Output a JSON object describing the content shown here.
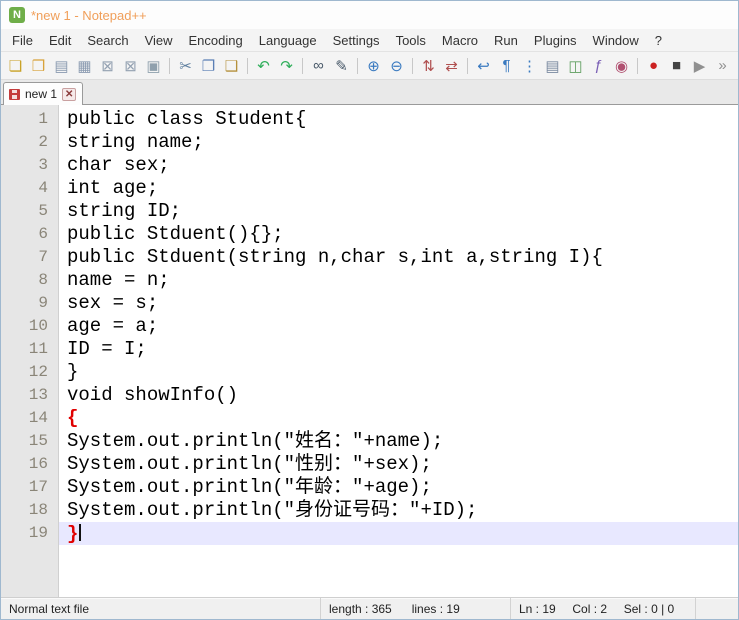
{
  "window": {
    "title": "*new 1 - Notepad++"
  },
  "colors": {
    "title_text": "#f09f5a",
    "app_icon_green": "#6fae49",
    "brace_match": "#e00000",
    "current_line_highlight": "#e8e8ff",
    "unsaved_tab_icon": "#c43c3c"
  },
  "menu_bar": {
    "items": [
      "File",
      "Edit",
      "Search",
      "View",
      "Encoding",
      "Language",
      "Settings",
      "Tools",
      "Macro",
      "Run",
      "Plugins",
      "Window",
      "?"
    ]
  },
  "toolbar": {
    "items": [
      {
        "name": "new-file-icon",
        "glyph": "❏",
        "color": "#c9a227"
      },
      {
        "name": "open-file-icon",
        "glyph": "❒",
        "color": "#d8a33c"
      },
      {
        "name": "save-file-icon",
        "glyph": "▤",
        "color": "#8a9ab0"
      },
      {
        "name": "save-all-icon",
        "glyph": "▦",
        "color": "#8a9ab0"
      },
      {
        "name": "close-file-icon",
        "glyph": "⊠",
        "color": "#93a1b1"
      },
      {
        "name": "close-all-icon",
        "glyph": "⊠",
        "color": "#93a1b1"
      },
      {
        "name": "print-icon",
        "glyph": "▣",
        "color": "#8fa0ad"
      },
      {
        "type": "sep"
      },
      {
        "name": "cut-icon",
        "glyph": "✂",
        "color": "#5f7f9f"
      },
      {
        "name": "copy-icon",
        "glyph": "❐",
        "color": "#5b7fb5"
      },
      {
        "name": "paste-icon",
        "glyph": "❑",
        "color": "#b5913c"
      },
      {
        "type": "sep"
      },
      {
        "name": "undo-icon",
        "glyph": "↶",
        "color": "#2fae5a"
      },
      {
        "name": "redo-icon",
        "glyph": "↷",
        "color": "#2fae5a"
      },
      {
        "type": "sep"
      },
      {
        "name": "find-icon",
        "glyph": "∞",
        "color": "#4a5a6a"
      },
      {
        "name": "replace-icon",
        "glyph": "✎",
        "color": "#4a5a6a"
      },
      {
        "type": "sep"
      },
      {
        "name": "zoom-in-icon",
        "glyph": "⊕",
        "color": "#3a7ac0"
      },
      {
        "name": "zoom-out-icon",
        "glyph": "⊖",
        "color": "#3a7ac0"
      },
      {
        "type": "sep"
      },
      {
        "name": "sync-vertical-scroll-icon",
        "glyph": "⇅",
        "color": "#b05050"
      },
      {
        "name": "sync-horizontal-scroll-icon",
        "glyph": "⇄",
        "color": "#b05050"
      },
      {
        "type": "sep"
      },
      {
        "name": "word-wrap-icon",
        "glyph": "↩",
        "color": "#3a7ac0"
      },
      {
        "name": "show-all-characters-icon",
        "glyph": "¶",
        "color": "#3a7ac0"
      },
      {
        "name": "indent-guide-icon",
        "glyph": "⋮",
        "color": "#3a7ac0"
      },
      {
        "name": "define-language-icon",
        "glyph": "▤",
        "color": "#7a8aa0"
      },
      {
        "name": "document-map-icon",
        "glyph": "◫",
        "color": "#5f9e5f"
      },
      {
        "name": "function-list-icon",
        "glyph": "ƒ",
        "color": "#7a5fb5"
      },
      {
        "name": "monitoring-icon",
        "glyph": "◉",
        "color": "#b05070"
      },
      {
        "type": "sep"
      },
      {
        "name": "record-macro-icon",
        "glyph": "●",
        "color": "#cc2222"
      },
      {
        "name": "stop-macro-icon",
        "glyph": "■",
        "color": "#444444"
      },
      {
        "name": "playback-macro-icon",
        "glyph": "▶",
        "color": "#909090"
      },
      {
        "name": "run-macro-multiple-icon",
        "glyph": "»",
        "color": "#909090"
      }
    ]
  },
  "tab": {
    "label": "new 1",
    "modified": true,
    "close_glyph": "✕"
  },
  "editor": {
    "lines": [
      {
        "num": 1,
        "parts": [
          {
            "text": "public class Student{"
          }
        ]
      },
      {
        "num": 2,
        "parts": [
          {
            "text": "string name;"
          }
        ]
      },
      {
        "num": 3,
        "parts": [
          {
            "text": "char sex;"
          }
        ]
      },
      {
        "num": 4,
        "parts": [
          {
            "text": "int age;"
          }
        ]
      },
      {
        "num": 5,
        "parts": [
          {
            "text": "string ID;"
          }
        ]
      },
      {
        "num": 6,
        "parts": [
          {
            "text": "public Stduent(){};"
          }
        ]
      },
      {
        "num": 7,
        "parts": [
          {
            "text": "public Stduent(string n,char s,int a,string I){"
          }
        ]
      },
      {
        "num": 8,
        "parts": [
          {
            "text": "name = n;"
          }
        ]
      },
      {
        "num": 9,
        "parts": [
          {
            "text": "sex = s;"
          }
        ]
      },
      {
        "num": 10,
        "parts": [
          {
            "text": "age = a;"
          }
        ]
      },
      {
        "num": 11,
        "parts": [
          {
            "text": "ID = I;"
          }
        ]
      },
      {
        "num": 12,
        "parts": [
          {
            "text": "}"
          }
        ]
      },
      {
        "num": 13,
        "parts": [
          {
            "text": "void showInfo()"
          }
        ]
      },
      {
        "num": 14,
        "parts": [
          {
            "text": "{",
            "style": "brace"
          }
        ]
      },
      {
        "num": 15,
        "parts": [
          {
            "text": "System.out.println(\"姓名：\"+name);"
          }
        ]
      },
      {
        "num": 16,
        "parts": [
          {
            "text": "System.out.println(\"性别：\"+sex);"
          }
        ]
      },
      {
        "num": 17,
        "parts": [
          {
            "text": "System.out.println(\"年龄：\"+age);"
          }
        ]
      },
      {
        "num": 18,
        "parts": [
          {
            "text": "System.out.println(\"身份证号码：\"+ID);"
          }
        ]
      },
      {
        "num": 19,
        "highlight": true,
        "cursor": true,
        "parts": [
          {
            "text": "}",
            "style": "brace"
          }
        ]
      }
    ]
  },
  "status_bar": {
    "doc_type": "Normal text file",
    "length_lines": "length : 365      lines : 19",
    "position": "Ln : 19     Col : 2     Sel : 0 | 0"
  }
}
